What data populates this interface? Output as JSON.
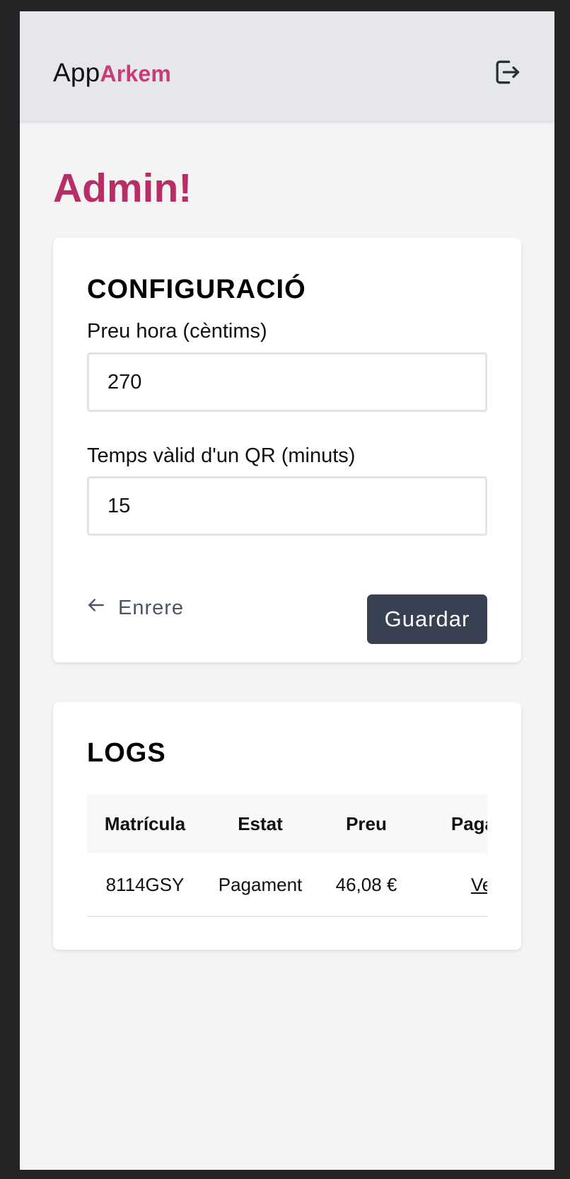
{
  "header": {
    "brand_prefix": "App",
    "brand_name": "Arkem",
    "logout_icon": "logout-icon"
  },
  "page": {
    "title": "Admin!"
  },
  "config": {
    "heading": "CONFIGURACIÓ",
    "price_label": "Preu hora (cèntims)",
    "price_value": "270",
    "qr_label": "Temps vàlid d'un QR (minuts)",
    "qr_value": "15",
    "back_label": "Enrere",
    "back_icon": "arrow-left-icon",
    "save_label": "Guardar"
  },
  "logs": {
    "heading": "LOGS",
    "columns": [
      "Matrícula",
      "Estat",
      "Preu",
      "Pagament"
    ],
    "rows": [
      {
        "plate": "8114GSY",
        "status": "Pagament",
        "price": "46,08 €",
        "link": "Veure"
      }
    ]
  },
  "colors": {
    "brand": "#c83c7a",
    "title": "#b72e66",
    "button": "#374151",
    "navbar": "#e5e7eb",
    "background": "#f4f4f5"
  }
}
